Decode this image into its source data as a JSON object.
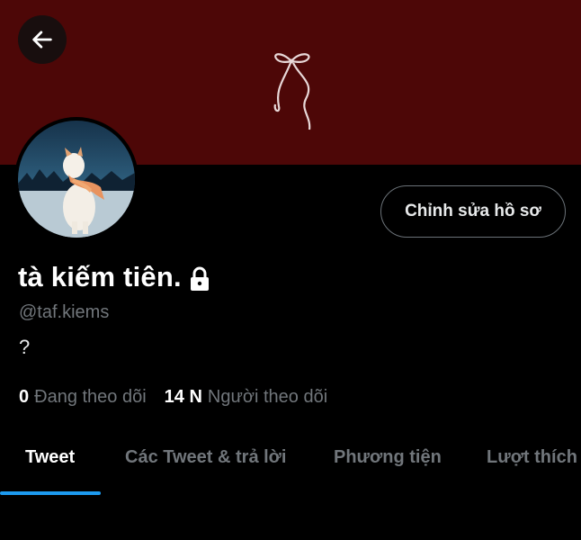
{
  "header": {
    "back_icon": "arrow-left-icon",
    "banner_color": "#4d0707",
    "banner_decoration": "ribbon-bow"
  },
  "profile": {
    "display_name": "tà kiếm tiên.",
    "lock_icon": "lock-icon",
    "handle": "@taf.kiems",
    "bio": "?",
    "edit_button_label": "Chỉnh sửa hồ sơ",
    "following_count": "0",
    "following_label": "Đang theo dõi",
    "followers_count": "14 N",
    "followers_label": "Người theo dõi"
  },
  "tabs": [
    {
      "label": "Tweet",
      "active": true
    },
    {
      "label": "Các Tweet & trả lời",
      "active": false
    },
    {
      "label": "Phương tiện",
      "active": false
    },
    {
      "label": "Lượt thích",
      "active": false
    }
  ],
  "colors": {
    "accent": "#1d9bf0",
    "muted_text": "#71767b",
    "background": "#000000"
  }
}
